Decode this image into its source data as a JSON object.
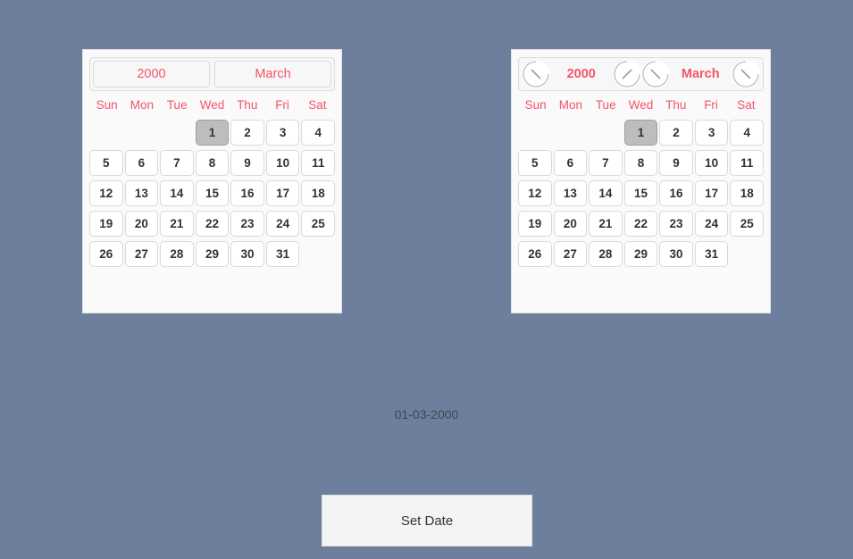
{
  "theme": {
    "background": "#6d7f9c",
    "panel_background": "#fafafa",
    "accent": "#f4556a",
    "selected_day_background": "#bdbdbd",
    "day_text": "#333333",
    "button_background": "#f4f4f4"
  },
  "calendars": [
    {
      "id": "left",
      "header_style": "buttons",
      "year": "2000",
      "month": "March",
      "weekdays": [
        "Sun",
        "Mon",
        "Tue",
        "Wed",
        "Thu",
        "Fri",
        "Sat"
      ],
      "leading_blanks": 3,
      "days": [
        "1",
        "2",
        "3",
        "4",
        "5",
        "6",
        "7",
        "8",
        "9",
        "10",
        "11",
        "12",
        "13",
        "14",
        "15",
        "16",
        "17",
        "18",
        "19",
        "20",
        "21",
        "22",
        "23",
        "24",
        "25",
        "26",
        "27",
        "28",
        "29",
        "30",
        "31"
      ],
      "selected_day": "1"
    },
    {
      "id": "right",
      "header_style": "spinners",
      "year": "2000",
      "month": "March",
      "weekdays": [
        "Sun",
        "Mon",
        "Tue",
        "Wed",
        "Thu",
        "Fri",
        "Sat"
      ],
      "leading_blanks": 3,
      "days": [
        "1",
        "2",
        "3",
        "4",
        "5",
        "6",
        "7",
        "8",
        "9",
        "10",
        "11",
        "12",
        "13",
        "14",
        "15",
        "16",
        "17",
        "18",
        "19",
        "20",
        "21",
        "22",
        "23",
        "24",
        "25",
        "26",
        "27",
        "28",
        "29",
        "30",
        "31"
      ],
      "selected_day": "1",
      "spinner_icons": [
        "year-decrement-icon",
        "year-increment-icon",
        "month-decrement-icon",
        "month-increment-icon"
      ]
    }
  ],
  "footer": {
    "date_readout": "01-03-2000",
    "set_date_label": "Set Date"
  }
}
